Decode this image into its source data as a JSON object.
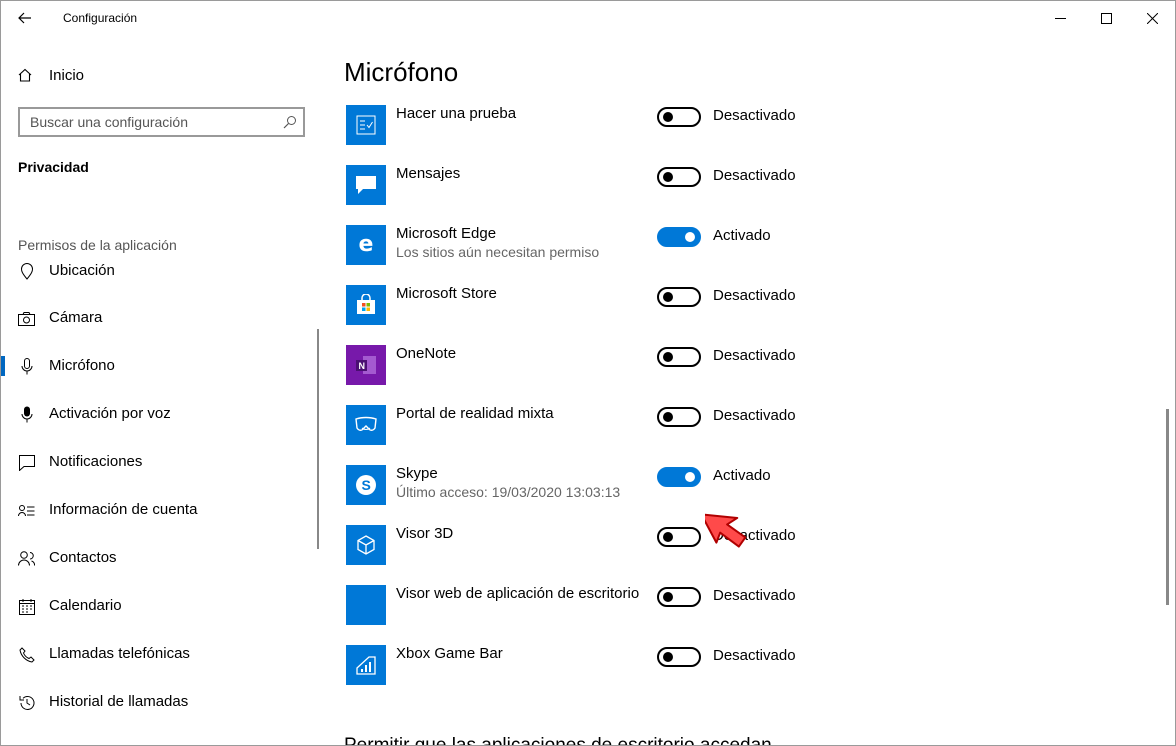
{
  "window": {
    "title": "Configuración"
  },
  "sidebar": {
    "home_label": "Inicio",
    "search_placeholder": "Buscar una configuración",
    "section": "Privacidad",
    "group": "Permisos de la aplicación",
    "items": [
      {
        "label": "Ubicación",
        "icon": "location-icon"
      },
      {
        "label": "Cámara",
        "icon": "camera-icon"
      },
      {
        "label": "Micrófono",
        "icon": "microphone-icon",
        "selected": true
      },
      {
        "label": "Activación por voz",
        "icon": "voice-activation-icon"
      },
      {
        "label": "Notificaciones",
        "icon": "notifications-icon"
      },
      {
        "label": "Información de cuenta",
        "icon": "account-info-icon"
      },
      {
        "label": "Contactos",
        "icon": "contacts-icon"
      },
      {
        "label": "Calendario",
        "icon": "calendar-icon"
      },
      {
        "label": "Llamadas telefónicas",
        "icon": "phone-icon"
      },
      {
        "label": "Historial de llamadas",
        "icon": "history-icon"
      }
    ]
  },
  "main": {
    "title": "Micrófono",
    "apps": [
      {
        "name": "Hacer una prueba",
        "sub": "",
        "state": "Desactivado",
        "on": false,
        "icon": "quiz-icon"
      },
      {
        "name": "Mensajes",
        "sub": "",
        "state": "Desactivado",
        "on": false,
        "icon": "messaging-icon"
      },
      {
        "name": "Microsoft Edge",
        "sub": "Los sitios aún necesitan permiso",
        "state": "Activado",
        "on": true,
        "icon": "edge-icon"
      },
      {
        "name": "Microsoft Store",
        "sub": "",
        "state": "Desactivado",
        "on": false,
        "icon": "store-icon"
      },
      {
        "name": "OneNote",
        "sub": "",
        "state": "Desactivado",
        "on": false,
        "icon": "onenote-icon"
      },
      {
        "name": "Portal de realidad mixta",
        "sub": "",
        "state": "Desactivado",
        "on": false,
        "icon": "mixed-reality-icon"
      },
      {
        "name": "Skype",
        "sub": "Último acceso: 19/03/2020 13:03:13",
        "state": "Activado",
        "on": true,
        "icon": "skype-icon"
      },
      {
        "name": "Visor 3D",
        "sub": "",
        "state": "Desactivado",
        "on": false,
        "icon": "viewer-3d-icon"
      },
      {
        "name": "Visor web de aplicación de escritorio",
        "sub": "",
        "state": "Desactivado",
        "on": false,
        "icon": "blank-app-icon"
      },
      {
        "name": "Xbox Game Bar",
        "sub": "",
        "state": "Desactivado",
        "on": false,
        "icon": "game-bar-icon"
      }
    ],
    "footer_heading": "Permitir que las aplicaciones de escritorio accedan"
  },
  "colors": {
    "accent": "#0078d7",
    "onenote": "#7719aa",
    "pointer": "#ff4a4a"
  }
}
